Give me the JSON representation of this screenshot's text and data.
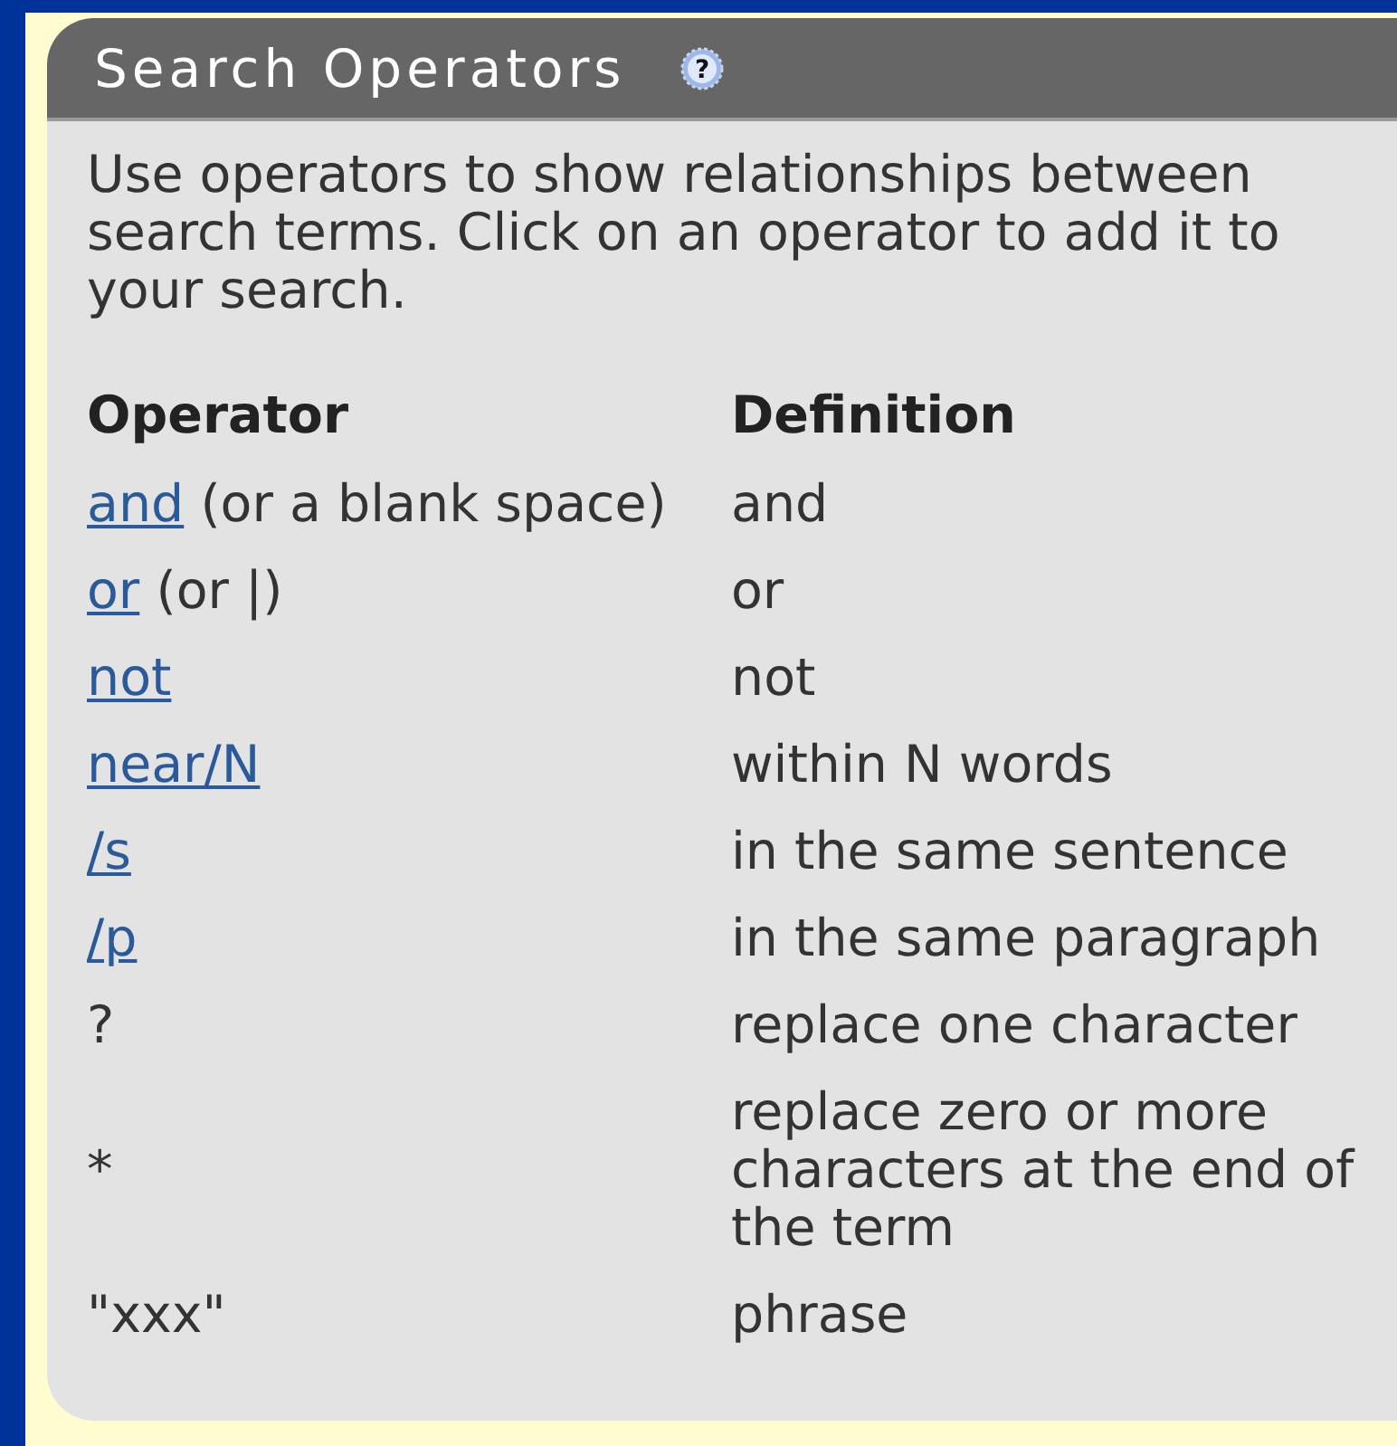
{
  "panel": {
    "title": "Search Operators",
    "help_icon": "?",
    "intro": "Use operators to show relationships between search terms. Click on an operator to add it to your search."
  },
  "table": {
    "columns": [
      "Operator",
      "Definition"
    ],
    "rows": [
      {
        "operator": "and",
        "note": "(or a blank space)",
        "linked": true,
        "definition": "and"
      },
      {
        "operator": "or",
        "note": "(or |)",
        "linked": true,
        "definition": "or"
      },
      {
        "operator": "not",
        "linked": true,
        "definition": "not"
      },
      {
        "operator": "near/N",
        "linked": true,
        "definition": "within N words"
      },
      {
        "operator": "/s",
        "linked": true,
        "definition": "in the same sentence"
      },
      {
        "operator": "/p",
        "linked": true,
        "definition": "in the same paragraph"
      },
      {
        "operator": "?",
        "linked": false,
        "definition": "replace one character"
      },
      {
        "operator": "*",
        "linked": false,
        "definition": "replace zero or more characters at the end of the term"
      },
      {
        "operator": "\"xxx\"",
        "linked": false,
        "definition": "phrase"
      }
    ]
  }
}
